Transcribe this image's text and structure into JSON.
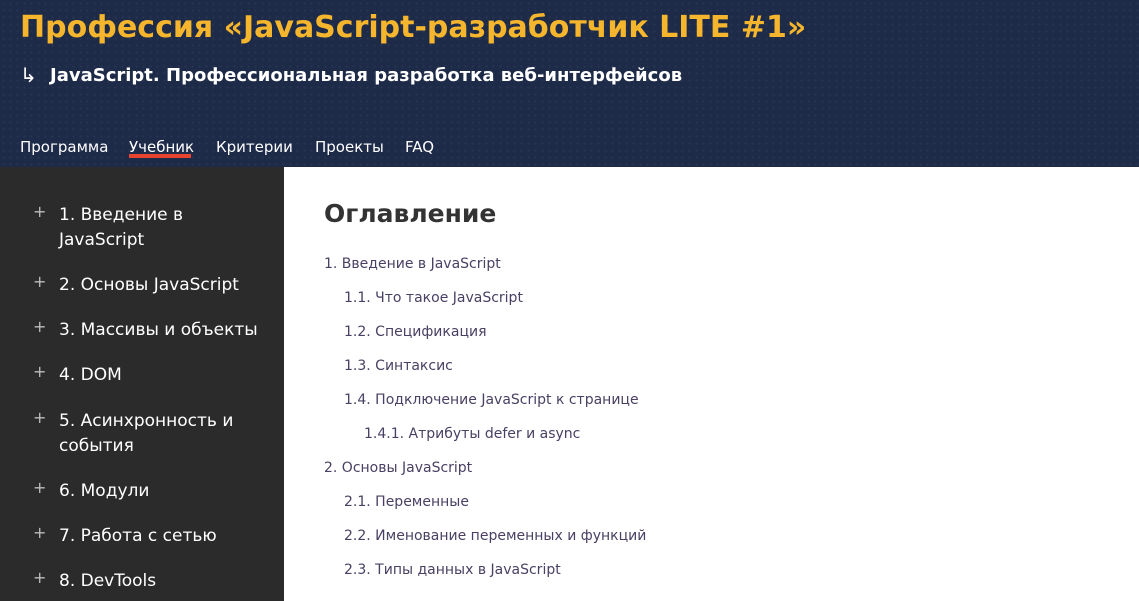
{
  "header": {
    "title": "Профессия «JavaScript-разработчик LITE #1»",
    "subtitle_arrow": "↳",
    "subtitle": "JavaScript. Профессиональная разработка веб-интерфейсов",
    "colors": {
      "background": "#1d2a48",
      "title": "#f5b52c",
      "active_tab_underline": "#e8432f"
    }
  },
  "nav": {
    "tabs": [
      {
        "label": "Программа",
        "active": false
      },
      {
        "label": "Учебник",
        "active": true
      },
      {
        "label": "Критерии",
        "active": false
      },
      {
        "label": "Проекты",
        "active": false
      },
      {
        "label": "FAQ",
        "active": false
      }
    ]
  },
  "sidebar": {
    "expand_icon": "+",
    "items": [
      {
        "label": "1. Введение в JavaScript"
      },
      {
        "label": "2. Основы JavaScript"
      },
      {
        "label": "3. Массивы и объекты"
      },
      {
        "label": "4. DOM"
      },
      {
        "label": "5. Асинхронность и события"
      },
      {
        "label": "6. Модули"
      },
      {
        "label": "7. Работа с сетью"
      },
      {
        "label": "8. DevTools"
      }
    ]
  },
  "toc": {
    "title": "Оглавление",
    "links": [
      {
        "label": "1. Введение в JavaScript",
        "level": 1
      },
      {
        "label": "1.1. Что такое JavaScript",
        "level": 2
      },
      {
        "label": "1.2. Спецификация",
        "level": 2
      },
      {
        "label": "1.3. Синтаксис",
        "level": 2
      },
      {
        "label": "1.4. Подключение JavaScript к странице",
        "level": 2
      },
      {
        "label": "1.4.1. Атрибуты defer и async",
        "level": 3
      },
      {
        "label": "2. Основы JavaScript",
        "level": 1
      },
      {
        "label": "2.1. Переменные",
        "level": 2
      },
      {
        "label": "2.2. Именование переменных и функций",
        "level": 2
      },
      {
        "label": "2.3. Типы данных в JavaScript",
        "level": 2
      }
    ]
  }
}
